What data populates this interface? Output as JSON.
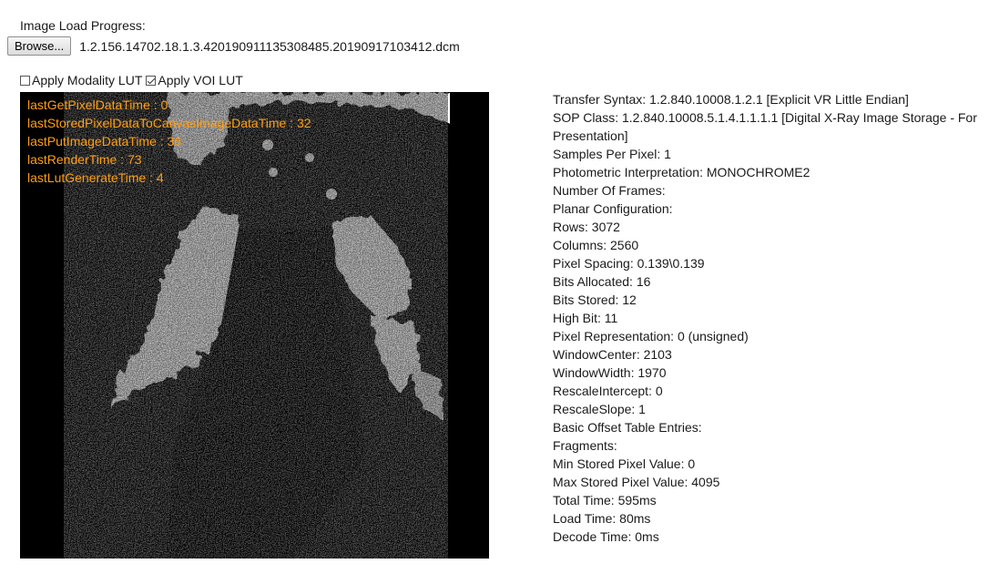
{
  "header": {
    "progress_label": "Image Load Progress:",
    "browse_label": "Browse...",
    "file_name": "1.2.156.14702.18.1.3.420190911135308485.20190917103412.dcm"
  },
  "options": {
    "modality_lut_label": "Apply Modality LUT",
    "modality_lut_checked": false,
    "voi_lut_label": "Apply VOI LUT",
    "voi_lut_checked": true
  },
  "overlay_stats": [
    "lastGetPixelDataTime : 0",
    "lastStoredPixelDataToCanvasImageDataTime : 32",
    "lastPutImageDataTime : 36",
    "lastRenderTime : 73",
    "lastLutGenerateTime : 4"
  ],
  "metadata": [
    "Transfer Syntax: 1.2.840.10008.1.2.1 [Explicit VR Little Endian]",
    "SOP Class: 1.2.840.10008.5.1.4.1.1.1.1 [Digital X-Ray Image Storage - For Presentation]",
    "Samples Per Pixel: 1",
    "Photometric Interpretation: MONOCHROME2",
    "Number Of Frames:",
    "Planar Configuration:",
    "Rows: 3072",
    "Columns: 2560",
    "Pixel Spacing: 0.139\\0.139",
    "Bits Allocated: 16",
    "Bits Stored: 12",
    "High Bit: 11",
    "Pixel Representation: 0 (unsigned)",
    "WindowCenter: 2103",
    "WindowWidth: 1970",
    "RescaleIntercept: 0",
    "RescaleSlope: 1",
    "Basic Offset Table Entries:",
    "Fragments:",
    "Min Stored Pixel Value: 0",
    "Max Stored Pixel Value: 4095",
    "Total Time: 595ms",
    "Load Time: 80ms",
    "Decode Time: 0ms"
  ],
  "colors": {
    "overlay_text": "#ff9f14",
    "viewport_background": "#000000"
  }
}
